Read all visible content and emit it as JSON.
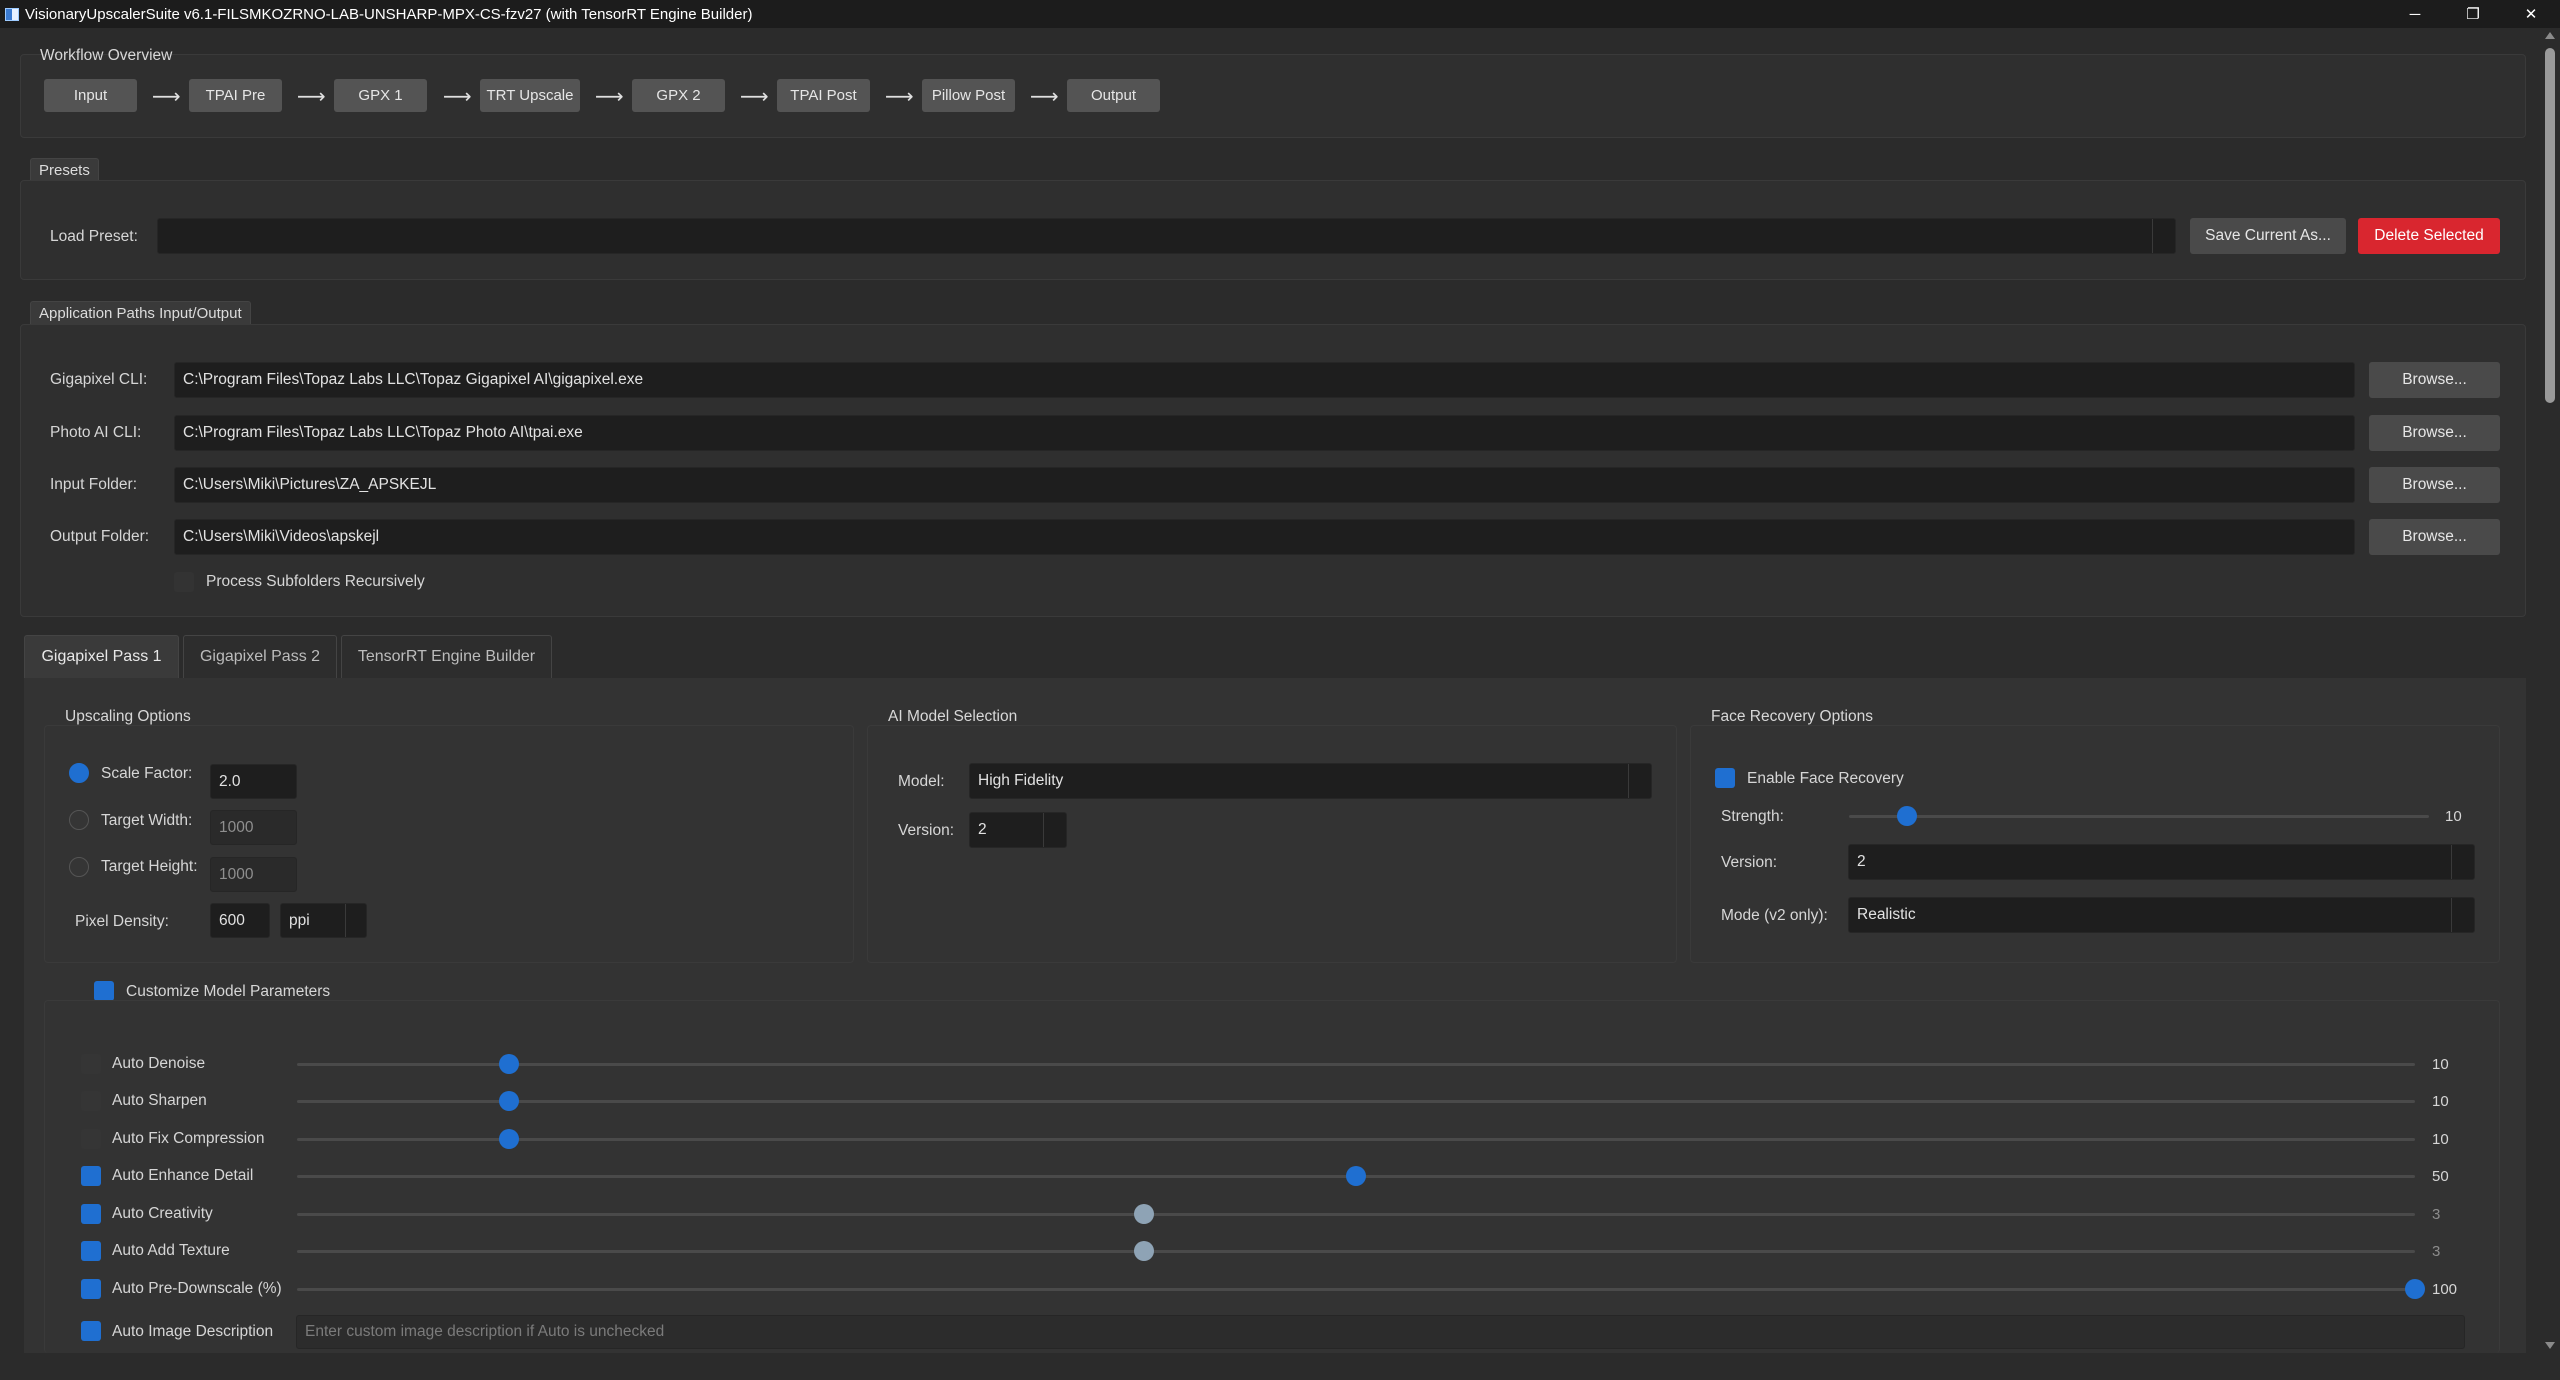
{
  "window": {
    "title": "VisionaryUpscalerSuite v6.1-FILSMKOZRNO-LAB-UNSHARP-MPX-CS-fzv27 (with TensorRT Engine Builder)",
    "minimize_glyph": "─",
    "maximize_glyph": "❐",
    "close_glyph": "✕"
  },
  "workflow": {
    "label": "Workflow Overview",
    "arrow": "⟶",
    "nodes": [
      "Input",
      "TPAI Pre",
      "GPX 1",
      "TRT Upscale",
      "GPX 2",
      "TPAI Post",
      "Pillow Post",
      "Output"
    ]
  },
  "presets": {
    "tab_label": "Presets",
    "load_label": "Load Preset:",
    "load_value": "",
    "save_button": "Save Current As...",
    "delete_button": "Delete Selected"
  },
  "paths": {
    "tab_label": "Application Paths  Input/Output",
    "rows": [
      {
        "label": "Gigapixel CLI:",
        "value": "C:\\Program Files\\Topaz Labs LLC\\Topaz Gigapixel AI\\gigapixel.exe",
        "button": "Browse..."
      },
      {
        "label": "Photo AI CLI:",
        "value": "C:\\Program Files\\Topaz Labs LLC\\Topaz Photo AI\\tpai.exe",
        "button": "Browse..."
      },
      {
        "label": "Input Folder:",
        "value": "C:\\Users\\Miki\\Pictures\\ZA_APSKEJL",
        "button": "Browse..."
      },
      {
        "label": "Output Folder:",
        "value": "C:\\Users\\Miki\\Videos\\apskejl",
        "button": "Browse..."
      }
    ],
    "recursive_label": "Process Subfolders Recursively"
  },
  "tabs": [
    "Gigapixel Pass 1",
    "Gigapixel Pass 2",
    "TensorRT Engine Builder"
  ],
  "upscaling": {
    "label": "Upscaling Options",
    "scale_label": "Scale Factor:",
    "scale_value": "2.0",
    "width_label": "Target Width:",
    "width_value": "1000",
    "height_label": "Target Height:",
    "height_value": "1000",
    "density_label": "Pixel Density:",
    "density_value": "600",
    "density_unit": "ppi"
  },
  "model": {
    "label": "AI Model Selection",
    "model_label": "Model:",
    "model_value": "High Fidelity",
    "version_label": "Version:",
    "version_value": "2"
  },
  "face": {
    "label": "Face Recovery Options",
    "enable_label": "Enable Face Recovery",
    "strength_label": "Strength:",
    "strength_value": "10",
    "strength_level": 0.1,
    "version_label": "Version:",
    "version_value": "2",
    "mode_label": "Mode (v2 only):",
    "mode_value": "Realistic"
  },
  "customize": {
    "label": "Customize Model Parameters",
    "params": [
      {
        "label": "Auto Denoise",
        "value": "10",
        "level": 0.1,
        "checked": false
      },
      {
        "label": "Auto Sharpen",
        "value": "10",
        "level": 0.1,
        "checked": false
      },
      {
        "label": "Auto Fix Compression",
        "value": "10",
        "level": 0.1,
        "checked": false
      },
      {
        "label": "Auto Enhance Detail",
        "value": "50",
        "level": 0.5,
        "checked": true
      },
      {
        "label": "Auto Creativity",
        "value": "3",
        "level": 0.4,
        "checked": true
      },
      {
        "label": "Auto Add Texture",
        "value": "3",
        "level": 0.4,
        "checked": true
      },
      {
        "label": "Auto Pre-Downscale (%)",
        "value": "100",
        "level": 1.0,
        "checked": true
      }
    ],
    "description_label": "Auto Image Description",
    "description_placeholder": "Enter custom image description if Auto is unchecked"
  },
  "colors": {
    "accent": "#1f6fd1",
    "danger": "#d9262f",
    "background": "#2b2b2b"
  }
}
